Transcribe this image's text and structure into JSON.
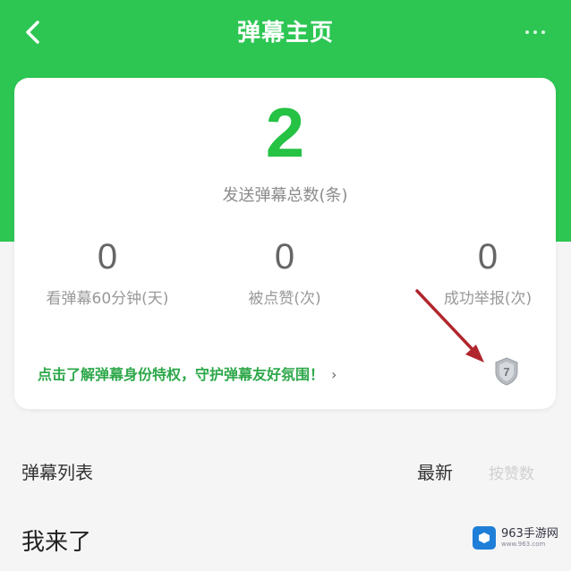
{
  "header": {
    "title": "弹幕主页",
    "accent_color": "#2dc653",
    "back_icon": "chevron-left-icon",
    "more_icon": "more-dots-icon"
  },
  "summary": {
    "total_sent": "2",
    "total_sent_label": "发送弹幕总数(条)",
    "stats": [
      {
        "value": "0",
        "label": "看弹幕60分钟(天)"
      },
      {
        "value": "0",
        "label": "被点赞(次)"
      },
      {
        "value": "0",
        "label": "成功举报(次)"
      }
    ],
    "privilege_link": "点击了解弹幕身份特权，守护弹幕友好氛围！",
    "privilege_chevron": "›",
    "level_badge": "7"
  },
  "list": {
    "title": "弹幕列表",
    "sort_newest": "最新",
    "sort_popular": "按赞数"
  },
  "items": [
    {
      "text": "我来了"
    }
  ],
  "watermark": {
    "name": "963手游网",
    "url": "www.963.com"
  }
}
